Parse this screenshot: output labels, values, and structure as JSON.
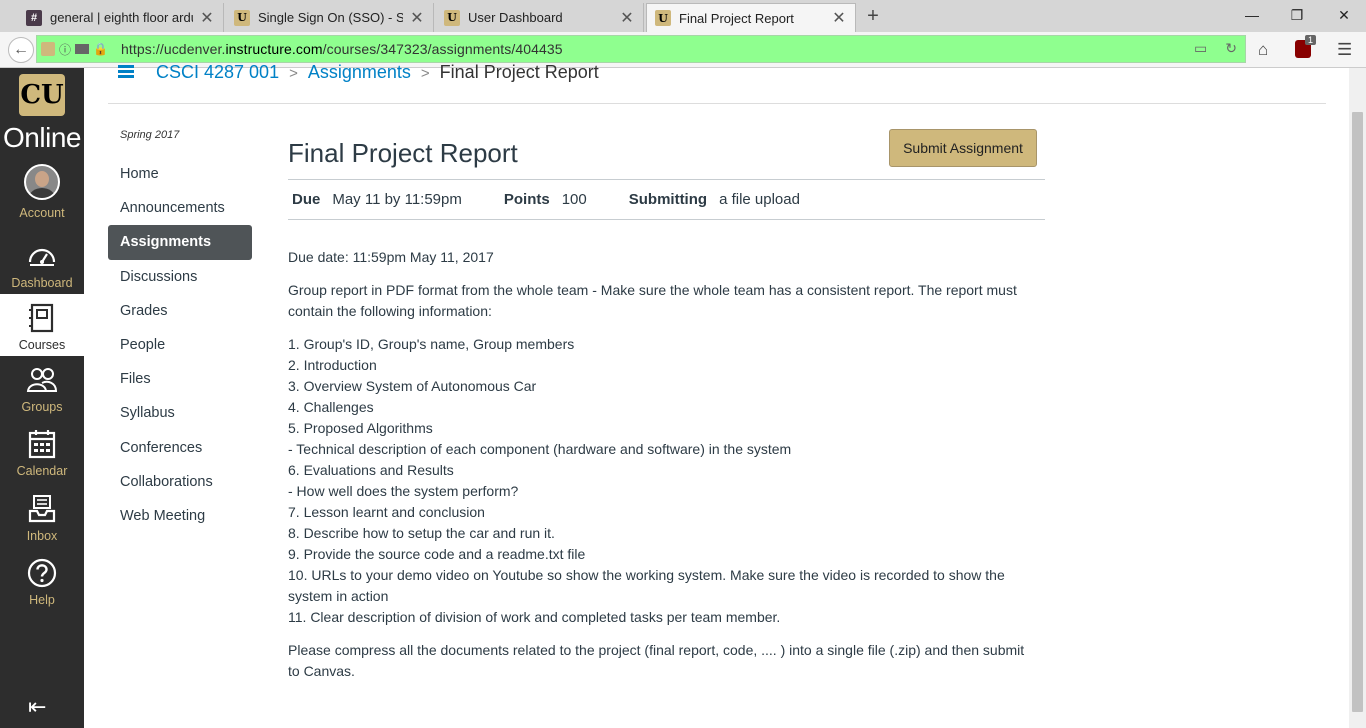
{
  "browser": {
    "tabs": [
      {
        "title": "general | eighth floor arduin",
        "favicon": "slack-icon"
      },
      {
        "title": "Single Sign On (SSO) - Servic",
        "favicon": "cu-icon"
      },
      {
        "title": "User Dashboard",
        "favicon": "cu-icon"
      },
      {
        "title": "Final Project Report",
        "favicon": "cu-icon"
      }
    ],
    "url_prefix": "https://ucdenver.",
    "url_domain": "instructure.com",
    "url_path": "/courses/347323/assignments/404435",
    "ublock_count": "1"
  },
  "global_nav": {
    "logo_text": "Online",
    "items": [
      {
        "label": "Account",
        "icon": "avatar"
      },
      {
        "label": "Dashboard",
        "icon": "dashboard-icon"
      },
      {
        "label": "Courses",
        "icon": "courses-icon"
      },
      {
        "label": "Groups",
        "icon": "groups-icon"
      },
      {
        "label": "Calendar",
        "icon": "calendar-icon"
      },
      {
        "label": "Inbox",
        "icon": "inbox-icon"
      },
      {
        "label": "Help",
        "icon": "help-icon"
      }
    ]
  },
  "breadcrumb": {
    "course": "CSCI 4287 001",
    "section": "Assignments",
    "current": "Final Project Report"
  },
  "course_nav": {
    "term": "Spring 2017",
    "items": [
      "Home",
      "Announcements",
      "Assignments",
      "Discussions",
      "Grades",
      "People",
      "Files",
      "Syllabus",
      "Conferences",
      "Collaborations",
      "Web Meeting"
    ],
    "active": "Assignments"
  },
  "assignment": {
    "title": "Final Project Report",
    "submit_label": "Submit Assignment",
    "due_label": "Due",
    "due_value": "May 11 by 11:59pm",
    "points_label": "Points",
    "points_value": "100",
    "submitting_label": "Submitting",
    "submitting_value": "a file upload",
    "due_date_line": "Due date: 11:59pm May 11, 2017",
    "intro": "Group report in PDF format from the whole team - Make sure the whole team has a consistent report. The report must contain the following information:",
    "list": [
      "1. Group's ID, Group's name, Group members",
      "2. Introduction",
      "3. Overview System of Autonomous Car",
      "4. Challenges",
      "5. Proposed Algorithms",
      "- Technical description of each component (hardware and software) in the system",
      "6. Evaluations and Results",
      "- How well does the system perform?",
      "7. Lesson learnt and conclusion",
      "8. Describe how to setup the car and run it.",
      "9. Provide the source code and a readme.txt file",
      "10. URLs to your demo video on Youtube so show the working system. Make sure the video is recorded to show the system in action",
      "11. Clear description of division of work and completed tasks per team member."
    ],
    "closing": "Please compress all the documents related to the project (final report, code, .... ) into a single file (.zip) and then submit to Canvas."
  },
  "colors": {
    "brand_gold": "#cfb87c",
    "nav_dark": "#2d2d2d",
    "link_blue": "#0081c6",
    "url_green": "#8fff8f"
  }
}
